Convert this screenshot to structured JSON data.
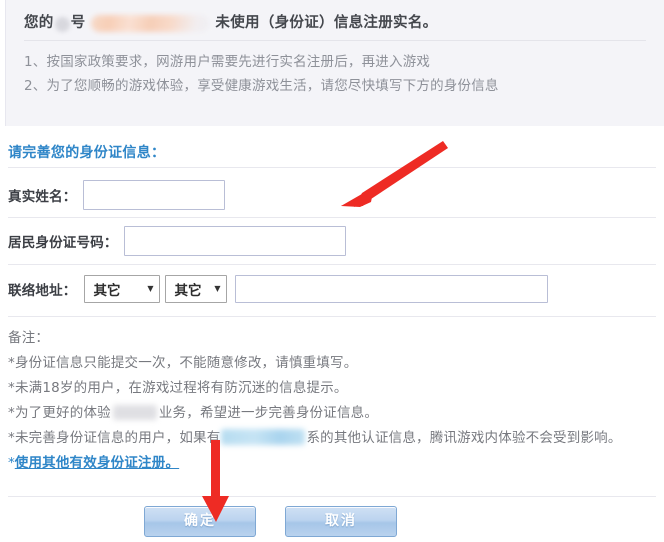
{
  "notice": {
    "title_prefix": "您的",
    "title_mid": "号",
    "title_suffix": "未使用（身份证）信息注册实名。",
    "lines": [
      "1、按国家政策要求，网游用户需要先进行实名注册后，再进入游戏",
      "2、为了您顺畅的游戏体验，享受健康游戏生活，请您尽快填写下方的身份信息"
    ]
  },
  "form": {
    "heading": "请完善您的身份证信息：",
    "real_name": {
      "label": "真实姓名：",
      "value": "",
      "placeholder": ""
    },
    "id_card": {
      "label": "居民身份证号码：",
      "value": "",
      "placeholder": ""
    },
    "address": {
      "label": "联络地址：",
      "province_value": "其它",
      "city_value": "其它",
      "detail_value": "",
      "detail_placeholder": "",
      "caret_glyph": "▼"
    }
  },
  "notes": {
    "title": "备注：",
    "line1": "*身份证信息只能提交一次，不能随意修改，请慎重填写。",
    "line2": "*未满18岁的用户，在游戏过程将有防沉迷的信息提示。",
    "line3_a": "*为了更好的体验",
    "line3_b": "业务，希望进一步完善身份证信息。",
    "line4_a": "*未完善身份证信息的用户，如果有",
    "line4_b": "系的其他认证信息，腾讯游戏内体验不会受到影响。",
    "link_star": "*",
    "link_text": "使用其他有效身份证注册。"
  },
  "buttons": {
    "confirm": "确定",
    "cancel": "取消"
  },
  "colors": {
    "accent_blue": "#2f86c8",
    "panel_bg": "#f4f4f8",
    "arrow_red": "#ee2b24",
    "input_border": "#b9bed6"
  }
}
